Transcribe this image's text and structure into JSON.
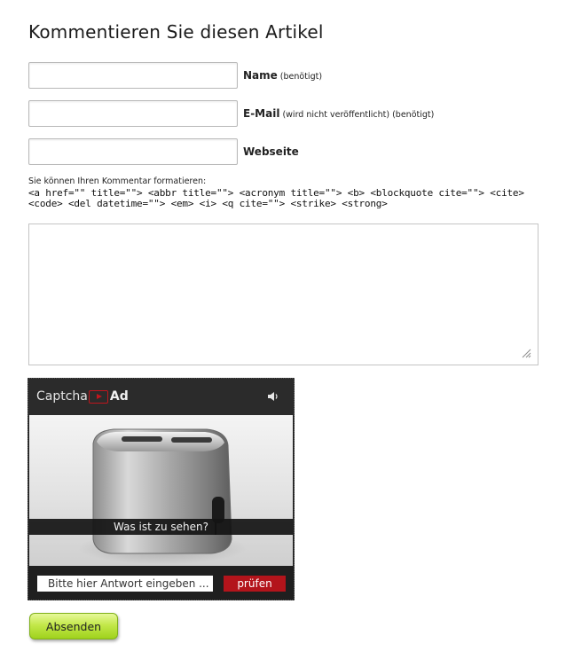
{
  "heading": "Kommentieren Sie diesen Artikel",
  "fields": {
    "name": {
      "label": "Name",
      "note": "(benötigt)",
      "value": ""
    },
    "email": {
      "label": "E-Mail",
      "note": "(wird nicht veröffentlicht) (benötigt)",
      "value": ""
    },
    "website": {
      "label": "Webseite",
      "note": "",
      "value": ""
    }
  },
  "format_hint": "Sie können Ihren Kommentar formatieren:",
  "allowed_tags": "<a href=\"\" title=\"\"> <abbr title=\"\"> <acronym title=\"\"> <b> <blockquote cite=\"\"> <cite> <code> <del datetime=\"\"> <em> <i> <q cite=\"\"> <strike> <strong>",
  "comment": {
    "value": ""
  },
  "captcha": {
    "logo_left": "Captcha",
    "logo_right": "Ad",
    "sound_icon": "speaker-icon",
    "question": "Was ist zu sehen?",
    "answer_placeholder": "Bitte hier Antwort eingeben ...",
    "check_label": "prüfen",
    "accent_color": "#b3141b"
  },
  "submit_label": "Absenden",
  "colors": {
    "submit_green": "#9fd21c",
    "captcha_dark": "#222222"
  }
}
